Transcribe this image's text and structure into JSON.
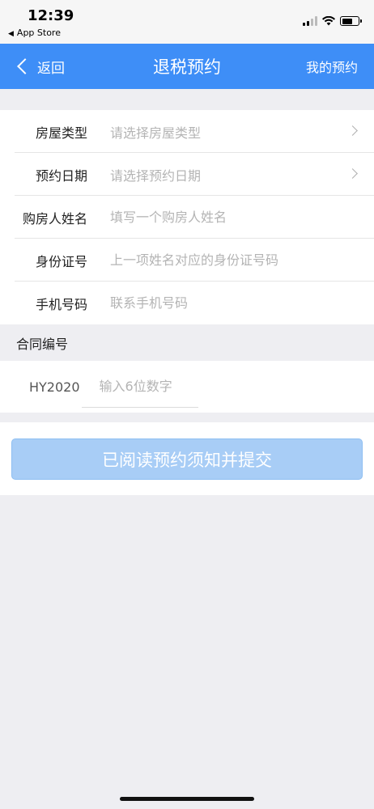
{
  "status_bar": {
    "time": "12:39",
    "back_app": "App Store"
  },
  "nav": {
    "back_label": "返回",
    "title": "退税预约",
    "right_label": "我的预约",
    "color": "#3e8ef7"
  },
  "form": {
    "rows": [
      {
        "label": "房屋类型",
        "placeholder": "请选择房屋类型",
        "chevron": true
      },
      {
        "label": "预约日期",
        "placeholder": "请选择预约日期",
        "chevron": true
      },
      {
        "label": "购房人姓名",
        "placeholder": "填写一个购房人姓名"
      },
      {
        "label": "身份证号",
        "placeholder": "上一项姓名对应的身份证号码"
      },
      {
        "label": "手机号码",
        "placeholder": "联系手机号码"
      }
    ]
  },
  "contract": {
    "header": "合同编号",
    "prefix": "HY2020",
    "placeholder": "输入6位数字"
  },
  "submit": {
    "label": "已阅读预约须知并提交",
    "color": "#a8cdf6"
  }
}
